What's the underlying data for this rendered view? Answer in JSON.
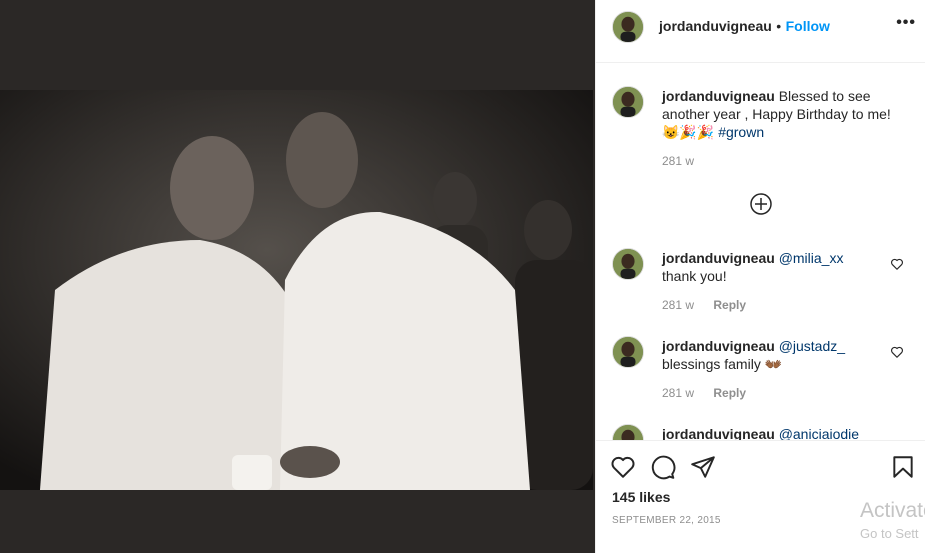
{
  "post": {
    "username": "jordanduvigneau",
    "follow_label": "Follow",
    "separator": "•",
    "more_label": "•••"
  },
  "caption": {
    "username": "jordanduvigneau",
    "text": "Blessed to see another year , Happy Birthday to me!",
    "emojis": "😺🎉🎉",
    "hashtag": "#grown",
    "time": "281 w"
  },
  "comments": [
    {
      "username": "jordanduvigneau",
      "mention": "@milia_xx",
      "text": "thank you!",
      "time": "281 w",
      "reply_label": "Reply"
    },
    {
      "username": "jordanduvigneau",
      "mention": "@justadz_",
      "text": "blessings family",
      "emoji": "👐🏾",
      "time": "281 w",
      "reply_label": "Reply"
    },
    {
      "username": "jordanduvigneau",
      "mention": "@aniciaiodie"
    }
  ],
  "footer": {
    "likes": "145 likes",
    "date": "SEPTEMBER 22, 2015"
  },
  "watermark": {
    "line1": "Activate",
    "line2": "Go to Sett"
  },
  "icons": [
    "like-heart-icon",
    "comment-icon",
    "share-icon",
    "save-bookmark-icon",
    "load-more-plus-icon",
    "more-options-icon"
  ],
  "colors": {
    "link": "#0095f6",
    "hashtag": "#00376b",
    "muted": "#8e8e8e",
    "text": "#262626"
  }
}
